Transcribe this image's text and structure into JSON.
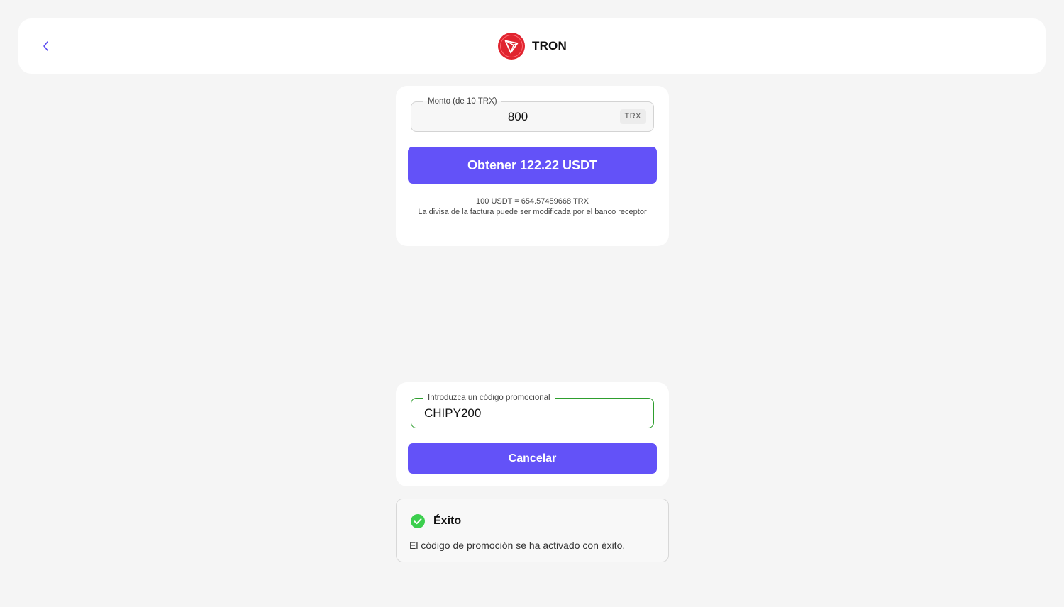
{
  "header": {
    "title": "TRON",
    "back_icon": "chevron-left-icon",
    "logo_icon": "tron-logo-icon",
    "accent_color": "#e0242f"
  },
  "amount_form": {
    "legend": "Monto (de 10 TRX)",
    "value": "800",
    "currency": "TRX",
    "submit_label": "Obtener 122.22 USDT",
    "rate": "100 USDT = 654.57459668 TRX",
    "note": "La divisa de la factura puede ser modificada por el banco receptor"
  },
  "promo_form": {
    "legend": "Introduzca un código promocional",
    "value": "CHIPY200",
    "cancel_label": "Cancelar"
  },
  "toast": {
    "icon": "check-circle-icon",
    "title": "Éxito",
    "message": "El código de promoción se ha activado con éxito.",
    "status_color": "#3ccf4e"
  },
  "colors": {
    "primary_button": "#6352f8",
    "valid_border": "#2e9e2e"
  }
}
